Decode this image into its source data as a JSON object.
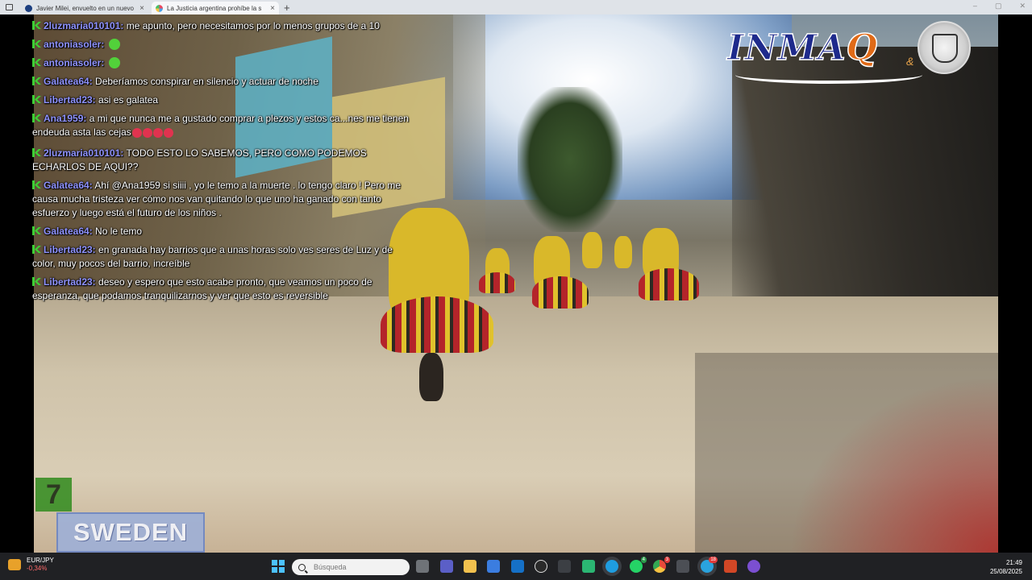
{
  "browser": {
    "tabs": [
      {
        "title": "Javier Milei, envuelto en un nuevo",
        "active": false
      },
      {
        "title": "La Justicia argentina prohíbe la s",
        "active": true
      }
    ],
    "new_tab": "+"
  },
  "chat": {
    "messages": [
      {
        "user": "2luzmaria010101:",
        "text": "me apunto, pero necesitamos por lo menos grupos de a 10",
        "emote": ""
      },
      {
        "user": "antoniasoler:",
        "text": "",
        "emote": "green"
      },
      {
        "user": "antoniasoler:",
        "text": "",
        "emote": "green"
      },
      {
        "user": "Galatea64:",
        "text": "Deberíamos conspirar en silencio y actuar de noche",
        "emote": ""
      },
      {
        "user": "Libertad23:",
        "text": "asi es galatea",
        "emote": ""
      },
      {
        "user": "Ana1959:",
        "text": "a mi que nunca me a gustado comprar a plezos y estos ca...nes me tienen endeuda asta las cejas",
        "emote": "red"
      },
      {
        "user": "2luzmaria010101:",
        "text": "TODO ESTO LO SABEMOS, PERO COMO PODEMOS ECHARLOS DE AQUI??",
        "emote": ""
      },
      {
        "user": "Galatea64:",
        "text": "Ahí @Ana1959 si siiii , yo le temo a la muerte . lo tengo claro ! Pero me causa mucha tristeza ver cómo nos van quitando lo que uno ha ganado con tanto esfuerzo y luego está el futuro de los niños .",
        "emote": ""
      },
      {
        "user": "Galatea64:",
        "text": "No le temo",
        "emote": ""
      },
      {
        "user": "Libertad23:",
        "text": "en granada hay barrios que a unas horas solo ves seres de Luz y de color, muy pocos del barrio, increíble",
        "emote": ""
      },
      {
        "user": "Libertad23:",
        "text": "deseo y espero que esto acabe pronto, que veamos un poco de esperanza, que podamos tranquilizarnos y ver que esto es reversible",
        "emote": ""
      }
    ]
  },
  "overlay": {
    "logo_main": "INMA",
    "logo_q": "Q",
    "logo_amp": "&",
    "rank": "7",
    "country": "SWEDEN"
  },
  "taskbar": {
    "ticker_symbol": "EUR/JPY",
    "ticker_change": "-0,34%",
    "search_placeholder": "Búsqueda",
    "time": "21:49",
    "date": "25/08/2025",
    "badges": {
      "whatsapp": "4",
      "chrome": "3",
      "telegram": "18"
    }
  },
  "colors": {
    "username": "#8f93ff",
    "moderator_badge": "#3ecf34",
    "rank_box": "#3a8f26",
    "country_box": "#9fb0d6",
    "taskbar": "#202124"
  }
}
